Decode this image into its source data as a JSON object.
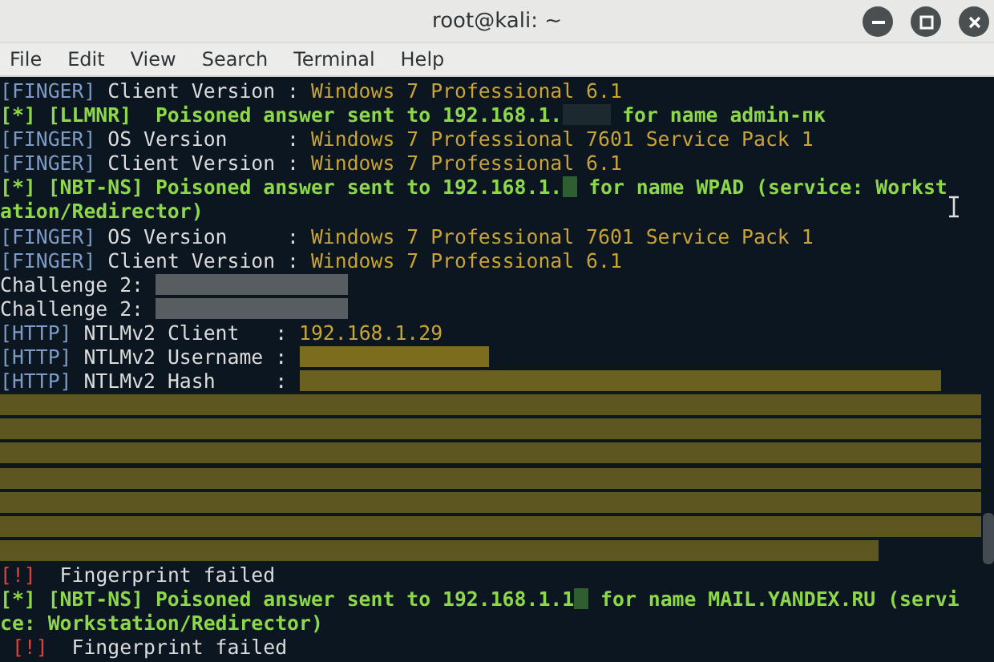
{
  "window": {
    "title": "root@kali: ~"
  },
  "menu": [
    "File",
    "Edit",
    "View",
    "Search",
    "Terminal",
    "Help"
  ],
  "lines": [
    [
      {
        "kind": "tag",
        "text": "[FINGER]"
      },
      {
        "kind": "label",
        "text": " Client Version : "
      },
      {
        "kind": "value",
        "text": "Windows 7 Professional 6.1"
      }
    ],
    [
      {
        "kind": "event",
        "text": "[*] [LLMNR]  Poisoned answer sent to 192.168.1."
      },
      {
        "kind": "redacted-dark"
      },
      {
        "kind": "event",
        "text": " for name admin-пк"
      }
    ],
    [
      {
        "kind": "tag",
        "text": "[FINGER]"
      },
      {
        "kind": "label",
        "text": " OS Version     : "
      },
      {
        "kind": "value",
        "text": "Windows 7 Professional 7601 Service Pack 1"
      }
    ],
    [
      {
        "kind": "tag",
        "text": "[FINGER]"
      },
      {
        "kind": "label",
        "text": " Client Version : "
      },
      {
        "kind": "value",
        "text": "Windows 7 Professional 6.1"
      }
    ],
    [
      {
        "kind": "event",
        "text": "[*] [NBT-NS] Poisoned answer sent to 192.168.1."
      },
      {
        "kind": "redacted-green"
      },
      {
        "kind": "event",
        "text": " for name WPAD (service: Workst"
      }
    ],
    [
      {
        "kind": "event",
        "text": "ation/Redirector)"
      }
    ],
    [
      {
        "kind": "tag",
        "text": "[FINGER]"
      },
      {
        "kind": "label",
        "text": " OS Version     : "
      },
      {
        "kind": "value",
        "text": "Windows 7 Professional 7601 Service Pack 1"
      }
    ],
    [
      {
        "kind": "tag",
        "text": "[FINGER]"
      },
      {
        "kind": "label",
        "text": " Client Version : "
      },
      {
        "kind": "value",
        "text": "Windows 7 Professional 6.1"
      }
    ],
    [
      {
        "kind": "label",
        "text": "Challenge 2: "
      },
      {
        "kind": "redacted-grey"
      }
    ],
    [
      {
        "kind": "label",
        "text": "Challenge 2: "
      },
      {
        "kind": "redacted-grey"
      }
    ],
    [
      {
        "kind": "tag",
        "text": "[HTTP]"
      },
      {
        "kind": "label",
        "text": " NTLMv2 Client   : "
      },
      {
        "kind": "value",
        "text": "192.168.1.29"
      }
    ],
    [
      {
        "kind": "tag",
        "text": "[HTTP]"
      },
      {
        "kind": "label",
        "text": " NTLMv2 Username : "
      },
      {
        "kind": "redacted-mosaic"
      }
    ],
    [
      {
        "kind": "tag",
        "text": "[HTTP]"
      },
      {
        "kind": "label",
        "text": " NTLMv2 Hash     : "
      },
      {
        "kind": "redacted-rest"
      }
    ],
    [
      {
        "kind": "redacted-line"
      }
    ],
    [
      {
        "kind": "redacted-line"
      }
    ],
    [
      {
        "kind": "redacted-line"
      }
    ],
    [
      {
        "kind": "redacted-line"
      }
    ],
    [
      {
        "kind": "redacted-line"
      }
    ],
    [
      {
        "kind": "redacted-line"
      }
    ],
    [
      {
        "kind": "redacted-partial"
      }
    ],
    [
      {
        "kind": "error",
        "text": "[!]"
      },
      {
        "kind": "label",
        "text": "  Fingerprint failed"
      }
    ],
    [
      {
        "kind": "event",
        "text": "[*] [NBT-NS] Poisoned answer sent to 192.168.1.1"
      },
      {
        "kind": "redacted-green"
      },
      {
        "kind": "event",
        "text": " for name MAIL.YANDEX.RU (servi"
      }
    ],
    [
      {
        "kind": "event",
        "text": "ce: Workstation/Redirector)"
      }
    ],
    [
      {
        "kind": "error",
        "text": " [!]"
      },
      {
        "kind": "label",
        "text": "  Fingerprint failed"
      }
    ]
  ]
}
